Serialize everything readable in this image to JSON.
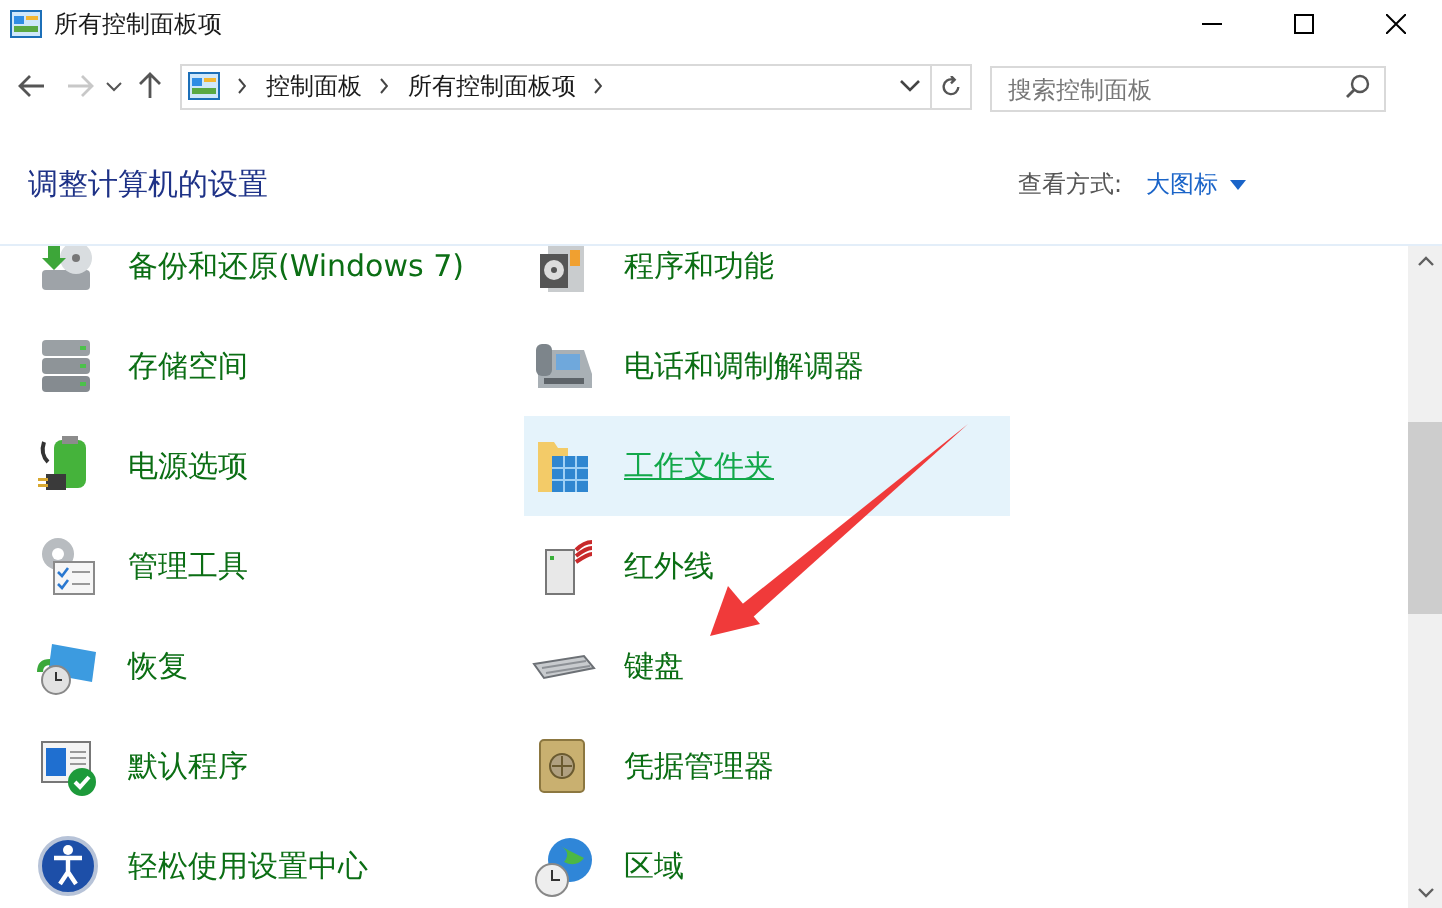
{
  "window": {
    "title": "所有控制面板项"
  },
  "address_bar": {
    "crumbs": [
      "控制面板",
      "所有控制面板项"
    ]
  },
  "search": {
    "placeholder": "搜索控制面板"
  },
  "heading": "调整计算机的设置",
  "view_by": {
    "label": "查看方式:",
    "value": "大图标"
  },
  "items": [
    {
      "label": "备份和还原(Windows 7)",
      "hovered": false
    },
    {
      "label": "程序和功能",
      "hovered": false
    },
    {
      "label": "存储空间",
      "hovered": false
    },
    {
      "label": "电话和调制解调器",
      "hovered": false
    },
    {
      "label": "电源选项",
      "hovered": false
    },
    {
      "label": "工作文件夹",
      "hovered": true
    },
    {
      "label": "管理工具",
      "hovered": false
    },
    {
      "label": "红外线",
      "hovered": false
    },
    {
      "label": "恢复",
      "hovered": false
    },
    {
      "label": "键盘",
      "hovered": false
    },
    {
      "label": "默认程序",
      "hovered": false
    },
    {
      "label": "凭据管理器",
      "hovered": false
    },
    {
      "label": "轻松使用设置中心",
      "hovered": false
    },
    {
      "label": "区域",
      "hovered": false
    }
  ]
}
